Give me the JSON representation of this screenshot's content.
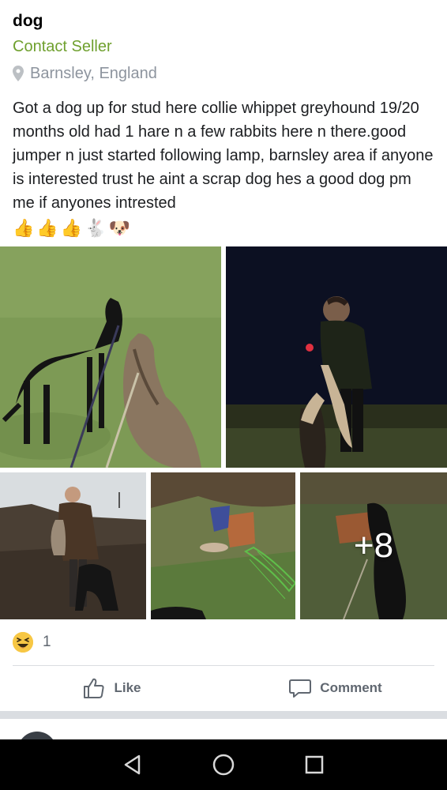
{
  "post": {
    "title": "dog",
    "contact_label": "Contact Seller",
    "location": "Barnsley, England",
    "description": "Got a dog up for stud here collie whippet greyhound 19/20 months old had 1 hare n a few rabbits here n there.good jumper n just started following lamp, barnsley area if anyone is interested trust he aint a scrap dog hes a good dog pm me if anyones intrested",
    "emojis": [
      "👍",
      "👍",
      "👍",
      "🐇",
      "🐶"
    ]
  },
  "photos": {
    "more_count": "+8"
  },
  "reactions": {
    "emoji": "😆",
    "count": "1"
  },
  "actions": {
    "like_label": "Like",
    "comment_label": "Comment"
  },
  "colors": {
    "accent": "#6fa02e",
    "muted": "#8d949e",
    "divider": "#dadde1"
  },
  "icons": {
    "location": "map-pin-icon",
    "like": "thumbs-up-icon",
    "comment": "speech-bubble-icon",
    "back": "nav-back-icon",
    "home": "nav-home-icon",
    "recents": "nav-recents-icon"
  }
}
